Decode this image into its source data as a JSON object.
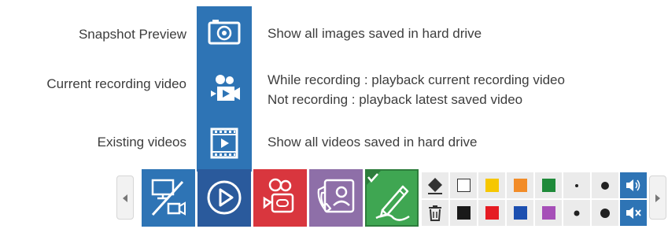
{
  "rows": [
    {
      "label": "Snapshot Preview",
      "desc_line1": "Show all images saved in hard drive",
      "desc_line2": "",
      "icon": "camera-icon"
    },
    {
      "label": "Current recording video",
      "desc_line1": "While recording : playback current recording video",
      "desc_line2": "Not recording : playback latest saved video",
      "icon": "recording-video-icon"
    },
    {
      "label": "Existing videos",
      "desc_line1": "Show all videos saved in hard drive",
      "desc_line2": "",
      "icon": "film-icon"
    }
  ],
  "toolbar": {
    "buttons": [
      {
        "name": "screen-switch-button",
        "icon": "screen-camera-icon",
        "color": "#2e74b5"
      },
      {
        "name": "play-button",
        "icon": "play-circle-icon",
        "color": "#2a5a9c"
      },
      {
        "name": "record-button",
        "icon": "video-recorder-icon",
        "color": "#d9363e"
      },
      {
        "name": "call-button",
        "icon": "video-call-icon",
        "color": "#8e6fa8"
      },
      {
        "name": "annotate-button",
        "icon": "pen-icon",
        "color": "#3fa652",
        "checked": true
      }
    ],
    "colors_top": [
      "#ffffff",
      "#f6c700",
      "#f28c28",
      "#1f8a3a"
    ],
    "colors_bottom": [
      "#1a1a1a",
      "#e51c23",
      "#1c4fb0",
      "#a64fb8"
    ],
    "tools": [
      "eraser-icon",
      "trash-icon",
      "small-dot-icon",
      "large-dot-icon",
      "volume-on-icon",
      "volume-mute-icon"
    ]
  }
}
